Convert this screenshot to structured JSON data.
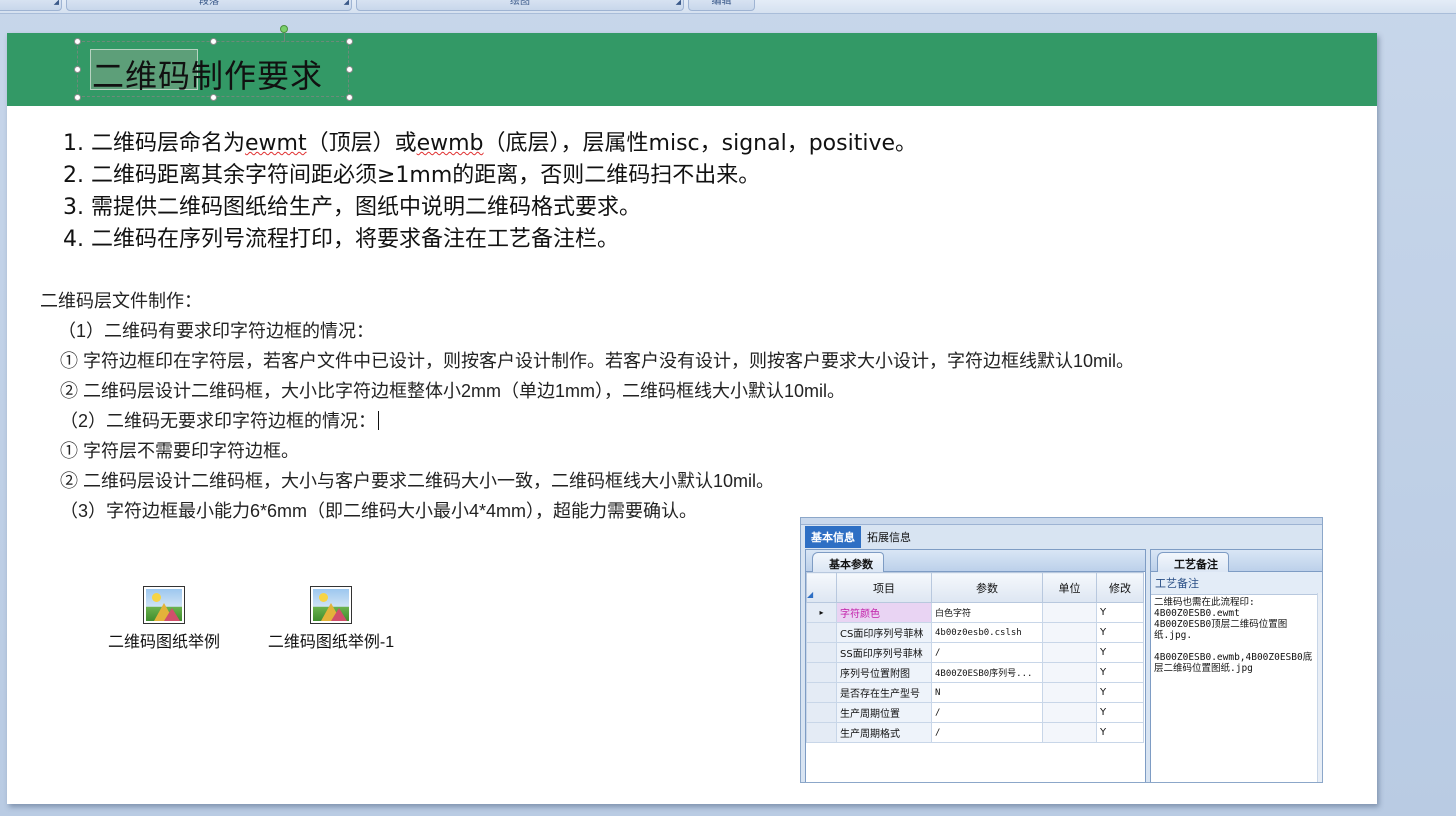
{
  "ribbon": {
    "groups": [
      {
        "label": ""
      },
      {
        "label": "段落"
      },
      {
        "label": "绘图"
      },
      {
        "label": "编辑"
      }
    ]
  },
  "slide": {
    "title": {
      "selected": "二维码",
      "rest": "制作要求"
    },
    "list": [
      {
        "prefix": "1. 二维码层命名为",
        "w1": "ewmt",
        "mid": "（顶层）或",
        "w2": "ewmb",
        "suffix": "（底层），层属性misc，signal，positive。"
      },
      {
        "text": "2. 二维码距离其余字符间距必须≥1mm的距离，否则二维码扫不出来。"
      },
      {
        "text": "3. 需提供二维码图纸给生产，图纸中说明二维码格式要求。"
      },
      {
        "text": "4. 二维码在序列号流程打印，将要求备注在工艺备注栏。"
      }
    ],
    "body": {
      "heading": "二维码层文件制作：",
      "case1": "（1）二维码有要求印字符边框的情况：",
      "case1_a": "①  字符边框印在字符层，若客户文件中已设计，则按客户设计制作。若客户没有设计，则按客户要求大小设计，字符边框线默认10mil。",
      "case1_b": "②  二维码层设计二维码框，大小比字符边框整体小2mm（单边1mm），二维码框线大小默认10mil。",
      "case2": "（2）二维码无要求印字符边框的情况：",
      "case2_a": "①  字符层不需要印字符边框。",
      "case2_b": "②  二维码层设计二维码框，大小与客户要求二维码大小一致，二维码框线大小默认10mil。",
      "case3": "（3）字符边框最小能力6*6mm（即二维码大小最小4*4mm），超能力需要确认。"
    },
    "objects": [
      {
        "label": "二维码图纸举例",
        "icon": "image-file-icon"
      },
      {
        "label": "二维码图纸举例-1",
        "icon": "image-file-icon"
      }
    ],
    "screenshot": {
      "tabs": [
        "基本信息",
        "拓展信息"
      ],
      "left_tab": "基本参数",
      "columns": [
        "项目",
        "参数",
        "单位",
        "修改"
      ],
      "rows": [
        {
          "marker": "▸",
          "item": "字符颜色",
          "value": "白色字符",
          "unit": "",
          "edit": "Y"
        },
        {
          "marker": "",
          "item": "CS面印序列号菲林",
          "value": "4b00z0esb0.cslsh",
          "unit": "",
          "edit": "Y"
        },
        {
          "marker": "",
          "item": "SS面印序列号菲林",
          "value": "/",
          "unit": "",
          "edit": "Y"
        },
        {
          "marker": "",
          "item": "序列号位置附图",
          "value": "4B00Z0ESB0序列号...",
          "unit": "",
          "edit": "Y"
        },
        {
          "marker": "",
          "item": "是否存在生产型号",
          "value": "N",
          "unit": "",
          "edit": "Y"
        },
        {
          "marker": "",
          "item": "生产周期位置",
          "value": "/",
          "unit": "",
          "edit": "Y"
        },
        {
          "marker": "",
          "item": "生产周期格式",
          "value": "/",
          "unit": "",
          "edit": "Y"
        }
      ],
      "right_tab": "工艺备注",
      "right_head": "工艺备注",
      "right_body": "二维码也需在此流程印:\n4B00Z0ESB0.ewmt\n4B00Z0ESB0顶层二维码位置图纸.jpg.\n\n4B00Z0ESB0.ewmb,4B00Z0ESB0底层二维码位置图纸.jpg"
    }
  }
}
